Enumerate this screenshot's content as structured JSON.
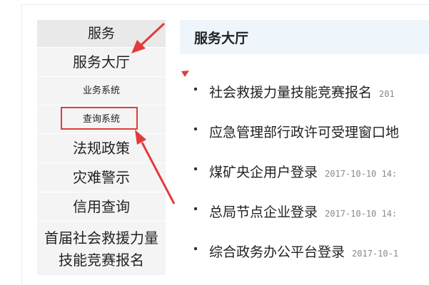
{
  "sidebar": {
    "header": "服务",
    "items": [
      {
        "label": "服务大厅",
        "size": "big"
      },
      {
        "label": "业务系统",
        "size": "small"
      },
      {
        "label": "查询系统",
        "size": "small"
      },
      {
        "label": "法规政策",
        "size": "big"
      },
      {
        "label": "灾难警示",
        "size": "big"
      },
      {
        "label": "信用查询",
        "size": "big"
      }
    ],
    "multiline_item": {
      "line1": "首届社会救援力量",
      "line2": "技能竞赛报名"
    }
  },
  "main": {
    "title": "服务大厅",
    "items": [
      {
        "title": "社会救援力量技能竞赛报名",
        "date": "201"
      },
      {
        "title": "应急管理部行政许可受理窗口地",
        "date": ""
      },
      {
        "title": "煤矿央企用户登录",
        "date": "2017-10-10 14:"
      },
      {
        "title": "总局节点企业登录",
        "date": "2017-10-10 14:"
      },
      {
        "title": "综合政务办公平台登录",
        "date": "2017-10-1"
      }
    ]
  },
  "annotation": {
    "color": "#e23b3b"
  }
}
